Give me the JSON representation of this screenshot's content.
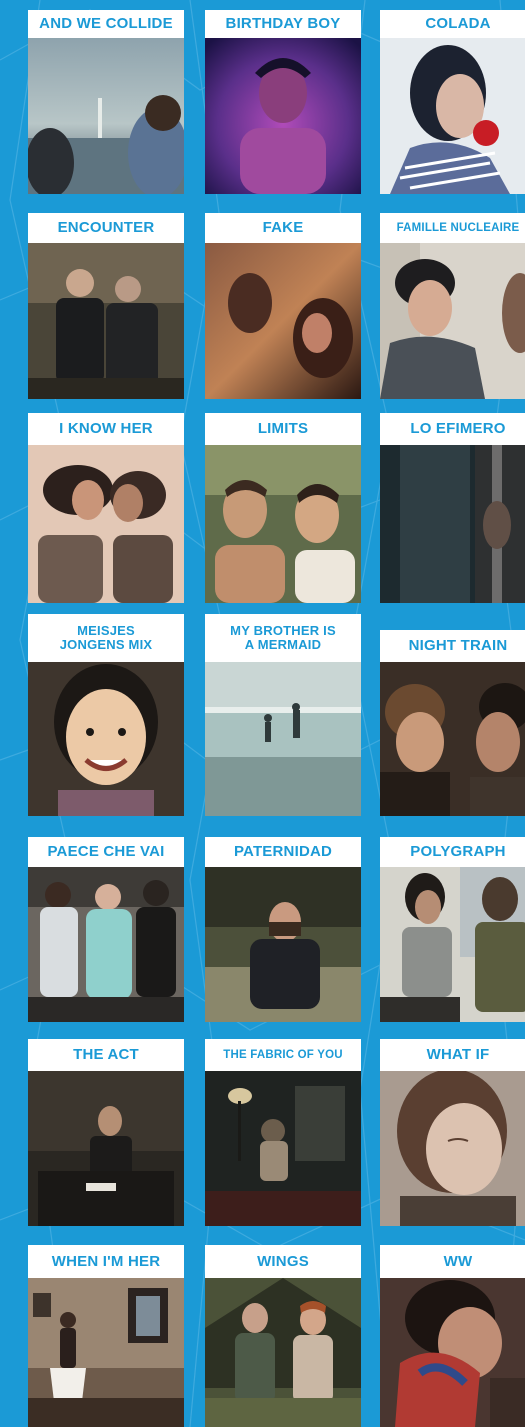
{
  "films": [
    {
      "title": "AND WE COLLIDE",
      "colors": [
        "#6f8a98",
        "#b7c4c4",
        "#2c3b45"
      ]
    },
    {
      "title": "BIRTHDAY BOY",
      "colors": [
        "#3a2a6e",
        "#a43fae",
        "#1a1040"
      ]
    },
    {
      "title": "COLADA",
      "colors": [
        "#e9eef2",
        "#c9cdd6",
        "#1e2532"
      ]
    },
    {
      "title": "ENCOUNTER",
      "colors": [
        "#3c3a33",
        "#7b6a52",
        "#14130f"
      ]
    },
    {
      "title": "FAKE",
      "colors": [
        "#7a4b35",
        "#c88c5e",
        "#2d1a14"
      ]
    },
    {
      "title": "FAMILLE NUCLEAIRE",
      "colors": [
        "#b9b3a8",
        "#e0dbd2",
        "#3e4249"
      ]
    },
    {
      "title": "I KNOW HER",
      "colors": [
        "#c7a48e",
        "#e6c8b2",
        "#3b2a25"
      ]
    },
    {
      "title": "LIMITS",
      "colors": [
        "#6f7b55",
        "#c9a47a",
        "#28301f"
      ]
    },
    {
      "title": "LO EFIMERO",
      "colors": [
        "#2b3a40",
        "#55666c",
        "#111a1e"
      ]
    },
    {
      "title": "MEISJES\nJONGENS MIX",
      "colors": [
        "#4a4036",
        "#e6c29c",
        "#1f1a16"
      ]
    },
    {
      "title": "MY BROTHER IS\nA MERMAID",
      "colors": [
        "#9fb7b4",
        "#d6e0dc",
        "#4b5f60"
      ]
    },
    {
      "title": "NIGHT TRAIN",
      "colors": [
        "#3d3128",
        "#8a6c55",
        "#120e0b"
      ]
    },
    {
      "title": "PAECE CHE VAI",
      "colors": [
        "#4d4a44",
        "#9bd2cd",
        "#1d1c1a"
      ]
    },
    {
      "title": "PATERNIDAD",
      "colors": [
        "#55593f",
        "#8c8a70",
        "#1f1e1b"
      ]
    },
    {
      "title": "POLYGRAPH",
      "colors": [
        "#c9c9c2",
        "#8e8f88",
        "#4a4d3e"
      ]
    },
    {
      "title": "THE ACT",
      "colors": [
        "#2d2a24",
        "#6b5c48",
        "#0f0e0c"
      ]
    },
    {
      "title": "THE FABRIC OF YOU",
      "colors": [
        "#2b2f2c",
        "#5a4f42",
        "#0e100f"
      ]
    },
    {
      "title": "WHAT IF",
      "colors": [
        "#9c8f86",
        "#d3c4b6",
        "#3d3631"
      ]
    },
    {
      "title": "WHEN I'M HER",
      "colors": [
        "#5a4a3e",
        "#a58f78",
        "#201a15"
      ]
    },
    {
      "title": "WINGS",
      "colors": [
        "#3f4530",
        "#b79e82",
        "#1b1f15"
      ]
    },
    {
      "title": "WW",
      "colors": [
        "#5a4038",
        "#b0574c",
        "#1f1613"
      ]
    }
  ]
}
